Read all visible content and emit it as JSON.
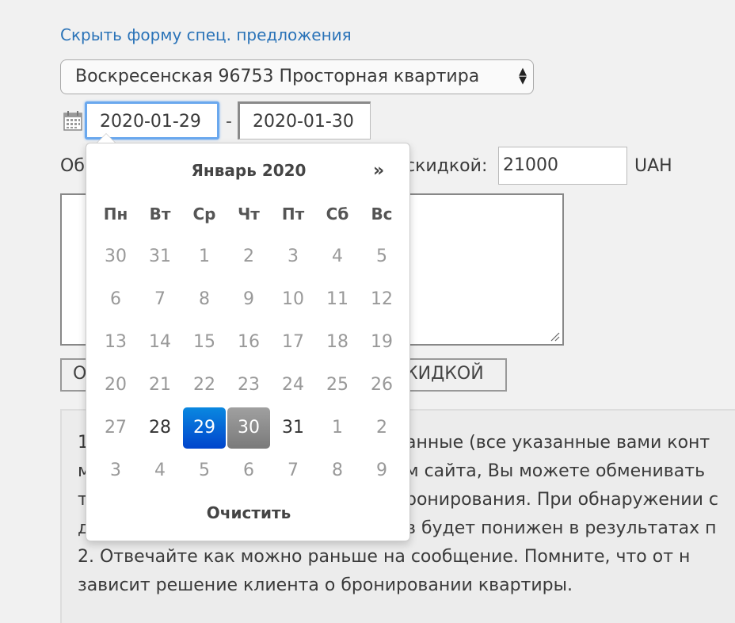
{
  "form": {
    "hide_link": "Скрыть форму спец. предложения",
    "apartment_select": "Воскресенская 96753 Просторная квартира",
    "date_from": "2020-01-29",
    "date_separator": "-",
    "date_to": "2020-01-30",
    "label_left": "Об",
    "label_right": "скидкой:",
    "price_value": "21000",
    "currency": "UAH",
    "submit_left": "О",
    "submit_right": "КИДКОЙ"
  },
  "notes": {
    "lines": [
      {
        "a": "1",
        "b": "анные (все указанные вами конт"
      },
      {
        "a": "м",
        "b": "м сайта, Вы можете обменивать"
      },
      {
        "a": "т",
        "b": "ронирования. При обнаружении с"
      },
      {
        "a": "д",
        "b": "в будет понижен в результатах п"
      }
    ],
    "line5": "2. Отвечайте как можно раньше на сообщение. Помните, что от н",
    "line6": "зависит решение клиента о бронировании квартиры."
  },
  "datepicker": {
    "month_title": "Январь 2020",
    "next_label": "»",
    "weekdays": [
      "Пн",
      "Вт",
      "Ср",
      "Чт",
      "Пт",
      "Сб",
      "Вс"
    ],
    "weeks": [
      [
        "30",
        "31",
        "1",
        "2",
        "3",
        "4",
        "5"
      ],
      [
        "6",
        "7",
        "8",
        "9",
        "10",
        "11",
        "12"
      ],
      [
        "13",
        "14",
        "15",
        "16",
        "17",
        "18",
        "19"
      ],
      [
        "20",
        "21",
        "22",
        "23",
        "24",
        "25",
        "26"
      ],
      [
        "27",
        "28",
        "29",
        "30",
        "31",
        "1",
        "2"
      ],
      [
        "3",
        "4",
        "5",
        "6",
        "7",
        "8",
        "9"
      ]
    ],
    "active_day": "29",
    "selected_day": "30",
    "clear_label": "Очистить"
  }
}
